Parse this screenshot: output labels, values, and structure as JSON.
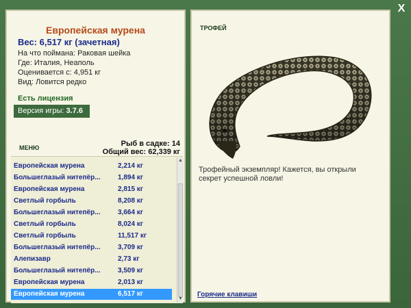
{
  "window": {
    "close_glyph": "X"
  },
  "fish": {
    "name": "Европейская мурена",
    "weight_line": "Вес: 6,517 кг (зачетная)",
    "bait": "На что поймана: Раковая шейка",
    "location": "Где: Италия, Неаполь",
    "value": "Оценивается с: 4,951 кг",
    "rarity": "Вид: Ловится редко"
  },
  "license": "Есть лицензия",
  "version": {
    "label": "Версия игры:",
    "number": "3.7.6"
  },
  "menu_label": "МЕНЮ",
  "stats": {
    "fish_count": "Рыб в садке: 14",
    "total_weight": "Общий вес: 62,339 кг"
  },
  "catch_list": [
    {
      "name": "Европейская мурена",
      "weight": "2,214 кг"
    },
    {
      "name": "Большеглазый нитепёр...",
      "weight": "1,894 кг"
    },
    {
      "name": "Европейская мурена",
      "weight": "2,815 кг"
    },
    {
      "name": "Светлый горбыль",
      "weight": "8,208 кг"
    },
    {
      "name": "Большеглазый нитепёр...",
      "weight": "3,664 кг"
    },
    {
      "name": "Светлый горбыль",
      "weight": "8,024 кг"
    },
    {
      "name": "Светлый горбыль",
      "weight": "11,517 кг"
    },
    {
      "name": "Большеглазый нитепёр...",
      "weight": "3,709 кг"
    },
    {
      "name": "Алепизавр",
      "weight": "2,73 кг"
    },
    {
      "name": "Большеглазый нитепёр...",
      "weight": "3,509 кг"
    },
    {
      "name": "Европейская мурена",
      "weight": "2,013 кг"
    },
    {
      "name": "Европейская мурена",
      "weight": "6,517 кг"
    }
  ],
  "selected_index": 11,
  "trophy": {
    "label": "ТРОФЕЙ",
    "text": "Трофейный экземпляр! Кажется, вы открыли секрет успешной ловли!"
  },
  "hotkeys_link": "Горячие клавиши"
}
